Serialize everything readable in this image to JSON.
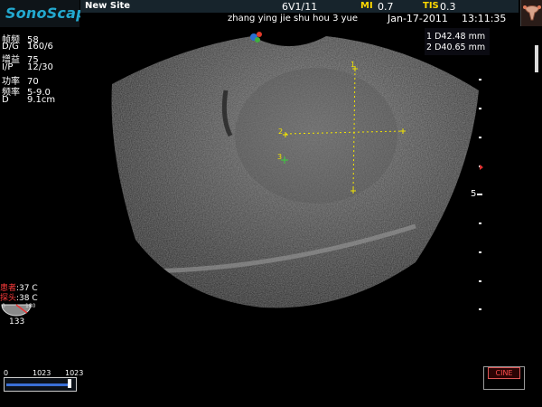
{
  "header": {
    "logo_text": "SonoScape",
    "site": "New Site",
    "probe_preset": "6V1/11",
    "mi_label": "MI",
    "mi_value": "0.7",
    "tis_label": "TIS",
    "tis_value": "0.3",
    "patient_name": "zhang ying jie shu hou 3 yue",
    "date": "Jan-17-2011",
    "time": "13:11:35"
  },
  "parameters": [
    {
      "label": "帧频",
      "value": "58"
    },
    {
      "label": "D/G",
      "value": "160/6"
    },
    {
      "label": "增益",
      "value": "75"
    },
    {
      "label": "I/P",
      "value": "12/30"
    },
    {
      "label": "功率",
      "value": "70"
    },
    {
      "label": "频率",
      "value": "5-9.0"
    },
    {
      "label": "D",
      "value": "9.1cm"
    }
  ],
  "measurements": [
    {
      "id": "1",
      "label": "D4",
      "value": "2.48 mm"
    },
    {
      "id": "2",
      "label": "D4",
      "value": "0.65 mm"
    }
  ],
  "markers": [
    "1",
    "2",
    "3"
  ],
  "temperatures": [
    {
      "label": "患者",
      "value": ":37 C"
    },
    {
      "label": "探头",
      "value": ":38 C"
    }
  ],
  "probe_angle": {
    "min": "0",
    "max": "180",
    "value": "133"
  },
  "grey_bar": {
    "min": "0",
    "mid": "1023",
    "max": "1023",
    "level": 1.0
  },
  "cine_label": "CINE",
  "depth_marker": "5",
  "colors": {
    "accent_yellow": "#ffd800",
    "logo_blue": "#23a9cf",
    "caliper_yellow": "#f2e400",
    "cine_red": "#ff4d4d"
  },
  "icons": {
    "orientation": "color-orientation-icon",
    "uterus": "uterus-preset-icon"
  }
}
